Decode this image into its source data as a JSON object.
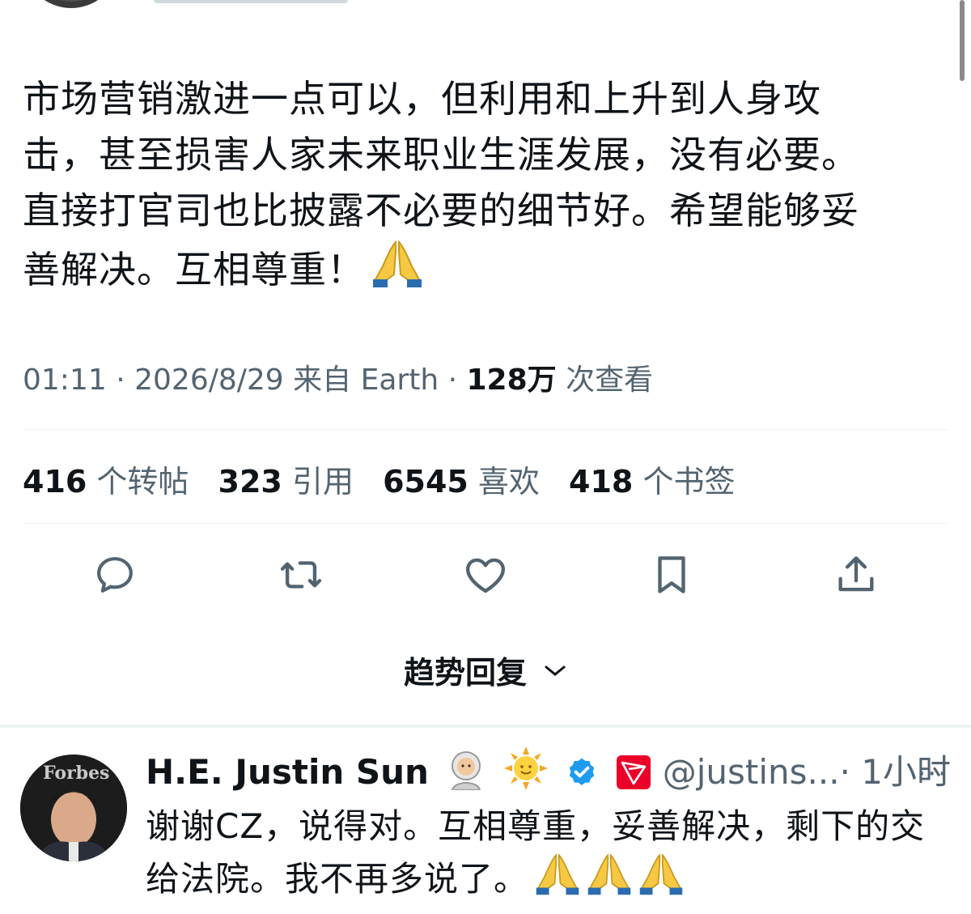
{
  "tweet": {
    "text_lines": [
      "市场营销激进一点可以，但利用和上升到人身攻",
      "击，甚至损害人家未来职业生涯发展，没有必要。",
      "直接打官司也比披露不必要的细节好。希望能够妥",
      "善解决。互相尊重！"
    ],
    "time": "01:11",
    "date": "2026/8/29",
    "source": "来自 Earth",
    "views_count": "128万",
    "views_label": "次查看",
    "dot": "·"
  },
  "stats": {
    "reposts_count": "416",
    "reposts_label": "个转帖",
    "quotes_count": "323",
    "quotes_label": "引用",
    "likes_count": "6545",
    "likes_label": "喜欢",
    "bookmarks_count": "418",
    "bookmarks_label": "个书签"
  },
  "actions": [
    "reply-icon",
    "retweet-icon",
    "heart-icon",
    "bookmark-icon",
    "share-icon"
  ],
  "trending": {
    "label": "趋势回复"
  },
  "reply": {
    "name": "H.E. Justin Sun",
    "handle": "@justins...",
    "time": "· 1小时",
    "more": "···",
    "avatar_label": "Forbes",
    "text_line1": "谢谢CZ，说得对。互相尊重，妥善解决，剩下的交",
    "text_line2": "给法院。我不再多说了。"
  },
  "colors": {
    "text": "#0f1419",
    "secondary": "#536471",
    "verified": "#1d9bf0",
    "tron": "#eb0029"
  }
}
